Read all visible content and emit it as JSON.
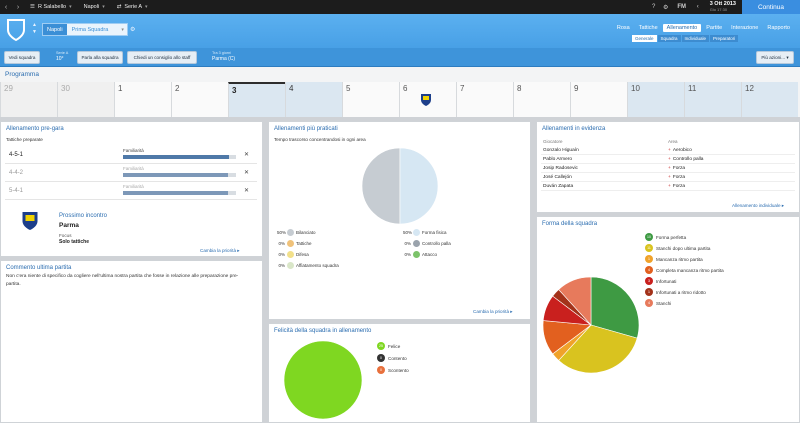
{
  "topbar": {
    "crumbs": [
      "R Salabello",
      "Napoli",
      "Serie A"
    ],
    "date_line1": "3 Ott 2013",
    "date_line2": "Gio 17:30",
    "fm_label": "FM",
    "continue_label": "Continua"
  },
  "header": {
    "club": "Napoli",
    "squad": "Prima Squadra",
    "nav": [
      "Rosa",
      "Tattiche",
      "Allenamento",
      "Partite",
      "Interazione",
      "Rapporto"
    ],
    "nav_active": "Allenamento",
    "subnav": [
      "Generale",
      "Squadra",
      "Individuale",
      "Preparatori"
    ],
    "subnav_active": "Generale"
  },
  "toolbar": {
    "btn_squadra": "Vedi squadra",
    "serie_label": "Serie A",
    "serie_value": "10°",
    "btn_parla": "Parla alla squadra",
    "btn_consiglio": "Chiedi un consiglio allo staff",
    "next_label": "Tra 3 giorni",
    "next_value": "Parma (C)",
    "more": "Più azioni..."
  },
  "programma": {
    "title": "Programma",
    "days": [
      "29",
      "30",
      "1",
      "2",
      "3",
      "4",
      "5",
      "6",
      "7",
      "8",
      "9",
      "10",
      "11",
      "12"
    ]
  },
  "pre_gara": {
    "title": "Allenamento pre-gara",
    "subtitle": "Tattiche preparate",
    "formations": [
      {
        "name": "4-5-1",
        "label": "Familiarità",
        "value": 0.94
      },
      {
        "name": "4-4-2",
        "label": "Familiarità",
        "value": 0.93
      },
      {
        "name": "5-4-1",
        "label": "Familiarità",
        "value": 0.93
      }
    ],
    "next_title": "Prossimo incontro",
    "next_team": "Parma",
    "focus_label": "Focus",
    "focus_value": "Solo tattiche",
    "change_link": "Cambia la priorità ▸"
  },
  "commento": {
    "title": "Commento ultima partita",
    "text": "Non c'era niente di specifico da cogliere nell'ultima nostra partita che fosse in relazione alle preparazione pre-partita."
  },
  "praticati": {
    "title": "Allenamenti più praticati",
    "subtitle": "Tempo trascorso concentrandosi in ogni area",
    "chart_data": {
      "type": "pie",
      "labels": [
        "Bilanciato",
        "Forma fisica",
        "Tattiche",
        "Controllo palla",
        "Difesa",
        "Attacco",
        "Affiatamento squadra"
      ],
      "values": [
        50,
        50,
        0,
        0,
        0,
        0,
        0
      ]
    },
    "colors": [
      "#c6ccd2",
      "#d6e7f3",
      "#f0c27a",
      "#9aa3ac",
      "#f2e08a",
      "#7cc36a",
      "#d9e6c8"
    ],
    "change_link": "Cambia la priorità ▸"
  },
  "felicita": {
    "title": "Felicità della squadra in allenamento",
    "chart_data": {
      "type": "pie",
      "labels": [
        "Felice",
        "Contento",
        "Scontento"
      ],
      "values": [
        25,
        0,
        0
      ]
    },
    "colors": [
      "#7fd721",
      "#333333",
      "#e8703c"
    ]
  },
  "evidenza": {
    "title": "Allenamenti in evidenza",
    "col_player": "Giocatore",
    "col_area": "Area",
    "rows": [
      {
        "player": "Gonzalo Higuaín",
        "area": "Aerobico"
      },
      {
        "player": "Pablo Armero",
        "area": "Controllo palla"
      },
      {
        "player": "Josip Radosevic",
        "area": "Forza"
      },
      {
        "player": "José Callejón",
        "area": "Forza"
      },
      {
        "player": "Duván Zapata",
        "area": "Forza"
      }
    ],
    "link": "Allenamento individuale ▸"
  },
  "forma": {
    "title": "Forma della squadra",
    "chart_data": {
      "type": "pie",
      "labels": [
        "Forma perfetta",
        "Stanchi dopo ultima partita",
        "Mancanza ritmo partita",
        "Completa mancanza ritmo partita",
        "Infortunati",
        "Infortunati a ritmo ridotto",
        "Stanchi"
      ],
      "values": [
        10,
        11,
        1,
        4,
        3,
        1,
        4
      ]
    },
    "colors": [
      "#3e9a43",
      "#d9c31f",
      "#f0a22a",
      "#e2601f",
      "#c9201e",
      "#a3321a",
      "#e77a5c"
    ]
  }
}
